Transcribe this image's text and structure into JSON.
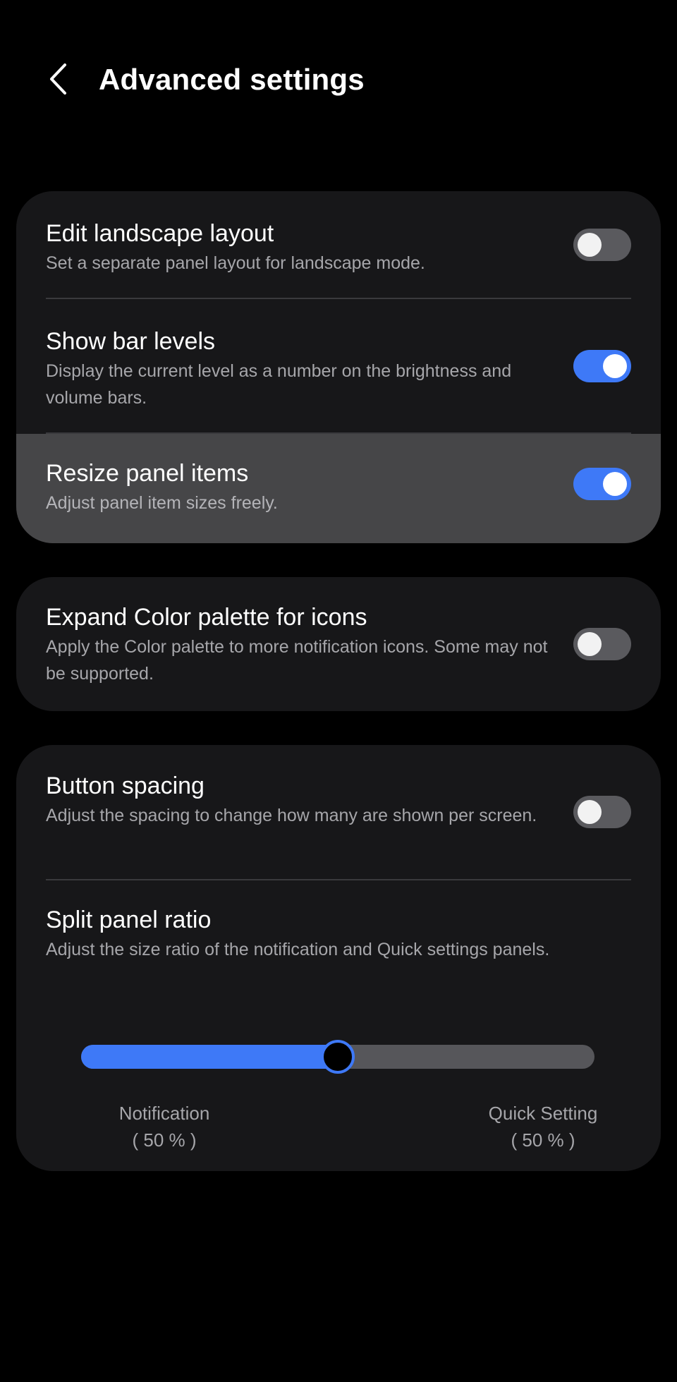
{
  "header": {
    "title": "Advanced settings",
    "back_icon": "chevron-left-icon"
  },
  "colors": {
    "accent": "#3e79f7",
    "card_bg": "#171719",
    "highlight_bg": "#464648",
    "toggle_off": "#5a5a5e",
    "page_bg": "#000000"
  },
  "cards": [
    {
      "rows": [
        {
          "title": "Edit landscape layout",
          "description": "Set a separate panel layout for landscape mode.",
          "toggle_on": false
        },
        {
          "title": "Show bar levels",
          "description": "Display the current level as a number on the brightness and volume bars.",
          "toggle_on": true
        },
        {
          "title": "Resize panel items",
          "description": "Adjust panel item sizes freely.",
          "toggle_on": true
        }
      ]
    },
    {
      "rows": [
        {
          "title": "Expand Color palette for icons",
          "description": "Apply the Color palette to more notification icons. Some may not be supported.",
          "toggle_on": false
        }
      ]
    },
    {
      "rows": [
        {
          "title": "Button spacing",
          "description": "Adjust the spacing to change how many are shown per screen.",
          "toggle_on": false
        },
        {
          "title": "Split panel ratio",
          "description": "Adjust the size ratio of the notification and Quick settings panels."
        }
      ],
      "slider": {
        "value_percent": 50,
        "left_label": "Notification",
        "left_value": "( 50 % )",
        "right_label": "Quick Setting",
        "right_value": "( 50 % )"
      }
    }
  ]
}
